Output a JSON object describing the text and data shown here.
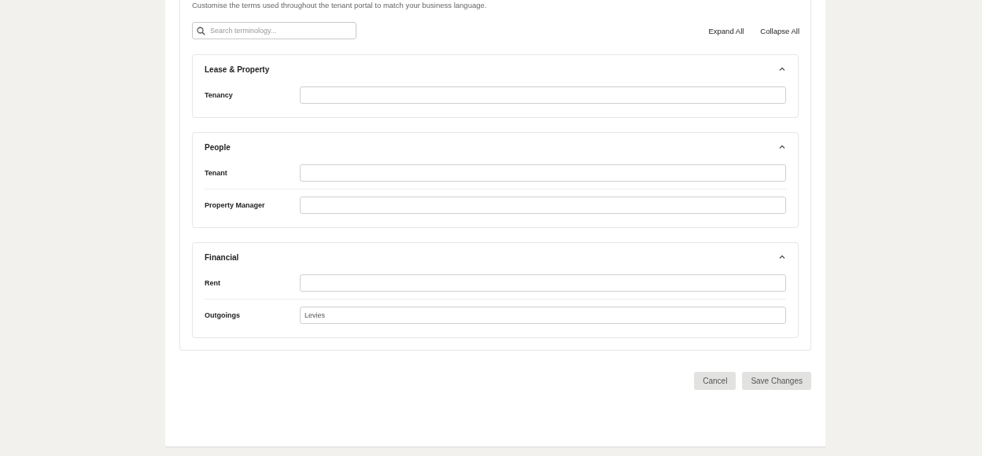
{
  "description": "Customise the terms used throughout the tenant portal to match your business language.",
  "search": {
    "placeholder": "Search terminology..."
  },
  "actions": [
    "Expand All",
    "Collapse All"
  ],
  "sections": [
    {
      "title": "Lease & Property",
      "expanded": true,
      "terms": [
        {
          "label": "Tenancy"
        }
      ]
    },
    {
      "title": "People",
      "expanded": true,
      "terms": [
        {
          "label": "Tenant"
        },
        {
          "label": "Property Manager"
        }
      ]
    },
    {
      "title": "Financial",
      "expanded": true,
      "terms": [
        {
          "label": "Rent"
        },
        {
          "label": "Outgoings",
          "value": "Levies"
        }
      ]
    }
  ],
  "buttons": [
    "Cancel",
    "Save Changes"
  ]
}
